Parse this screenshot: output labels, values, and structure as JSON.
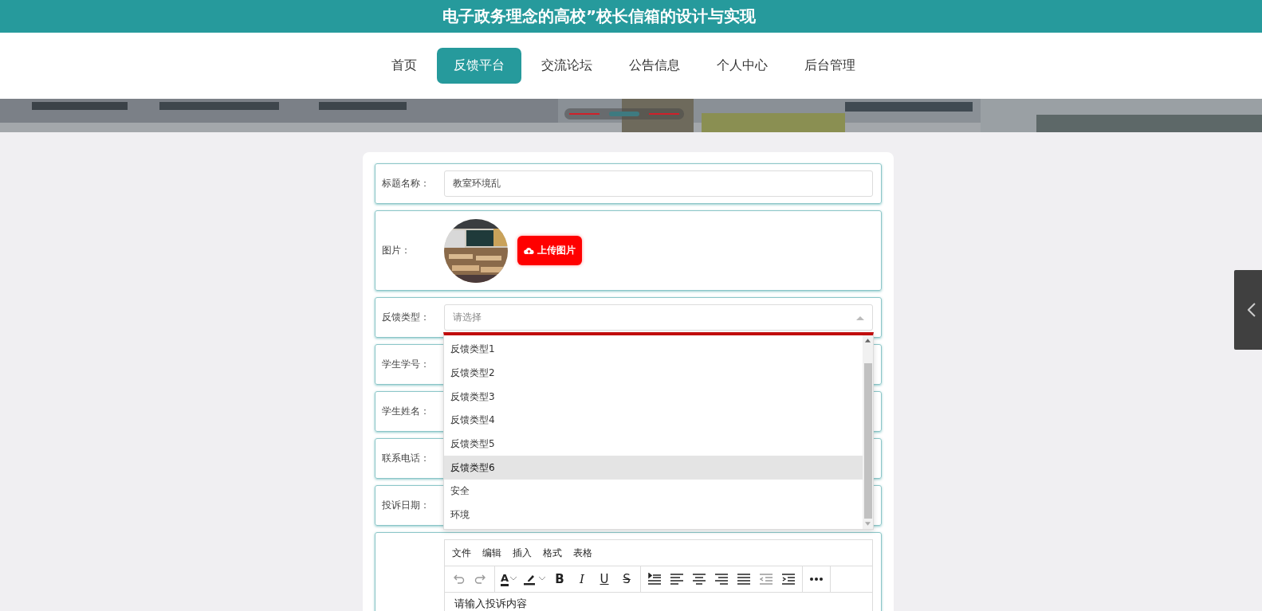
{
  "header": {
    "title": "电子政务理念的高校”校长信箱的设计与实现"
  },
  "nav": [
    {
      "label": "首页",
      "selected": false
    },
    {
      "label": "反馈平台",
      "selected": true
    },
    {
      "label": "交流论坛",
      "selected": false
    },
    {
      "label": "公告信息",
      "selected": false
    },
    {
      "label": "个人中心",
      "selected": false
    },
    {
      "label": "后台管理",
      "selected": false
    }
  ],
  "banner": {
    "kind": "picture",
    "indicators": [
      {
        "selected": false
      },
      {
        "selected": true
      },
      {
        "selected": false
      }
    ]
  },
  "form": {
    "rows": [
      {
        "kind": "text",
        "label": "标题名称：",
        "value": "教室环境乱"
      },
      {
        "label": "图片：",
        "button": "上传图片"
      },
      {
        "kind": "select",
        "label": "反馈类型：",
        "placeholder": "请选择",
        "expanded": true
      },
      {
        "kind": "covered",
        "label": "学生学号："
      },
      {
        "kind": "covered",
        "label": "学生姓名："
      },
      {
        "kind": "covered",
        "label": "联系电话："
      },
      {
        "kind": "covered",
        "label": "投诉日期："
      },
      {
        "kind": "editor",
        "menu": [
          "文件",
          "编辑",
          "插入",
          "格式",
          "表格"
        ],
        "placeholder": "请输入投诉内容",
        "toolbar": [
          [
            {
              "kind": "undo",
              "disabled": true
            },
            {
              "kind": "redo",
              "disabled": true
            }
          ],
          [
            {
              "kind": "fontcolor",
              "glyph": "A",
              "disabled": false
            },
            {
              "kind": "highlight",
              "disabled": false
            },
            {
              "kind": "bold",
              "glyph": "B",
              "disabled": false
            },
            {
              "kind": "italic",
              "glyph": "I",
              "disabled": false
            },
            {
              "kind": "underline",
              "glyph": "U",
              "disabled": false
            },
            {
              "kind": "strike",
              "glyph": "S",
              "disabled": false
            }
          ],
          [
            {
              "kind": "lineheight",
              "disabled": false
            },
            {
              "kind": "alignleft",
              "disabled": false
            },
            {
              "kind": "aligncenter",
              "disabled": false
            },
            {
              "kind": "alignright",
              "disabled": false
            },
            {
              "kind": "justify",
              "disabled": false
            },
            {
              "kind": "outdent",
              "disabled": true
            },
            {
              "kind": "indent",
              "disabled": false
            }
          ],
          [
            {
              "kind": "more",
              "disabled": false
            }
          ]
        ]
      }
    ]
  },
  "dropdown": {
    "options": [
      {
        "label": "反馈类型1",
        "hovered": false
      },
      {
        "label": "反馈类型2",
        "hovered": false
      },
      {
        "label": "反馈类型3",
        "hovered": false
      },
      {
        "label": "反馈类型4",
        "hovered": false
      },
      {
        "label": "反馈类型5",
        "hovered": false
      },
      {
        "label": "反馈类型6",
        "hovered": true
      },
      {
        "label": "安全",
        "hovered": false
      },
      {
        "label": "环境",
        "hovered": false
      }
    ]
  }
}
